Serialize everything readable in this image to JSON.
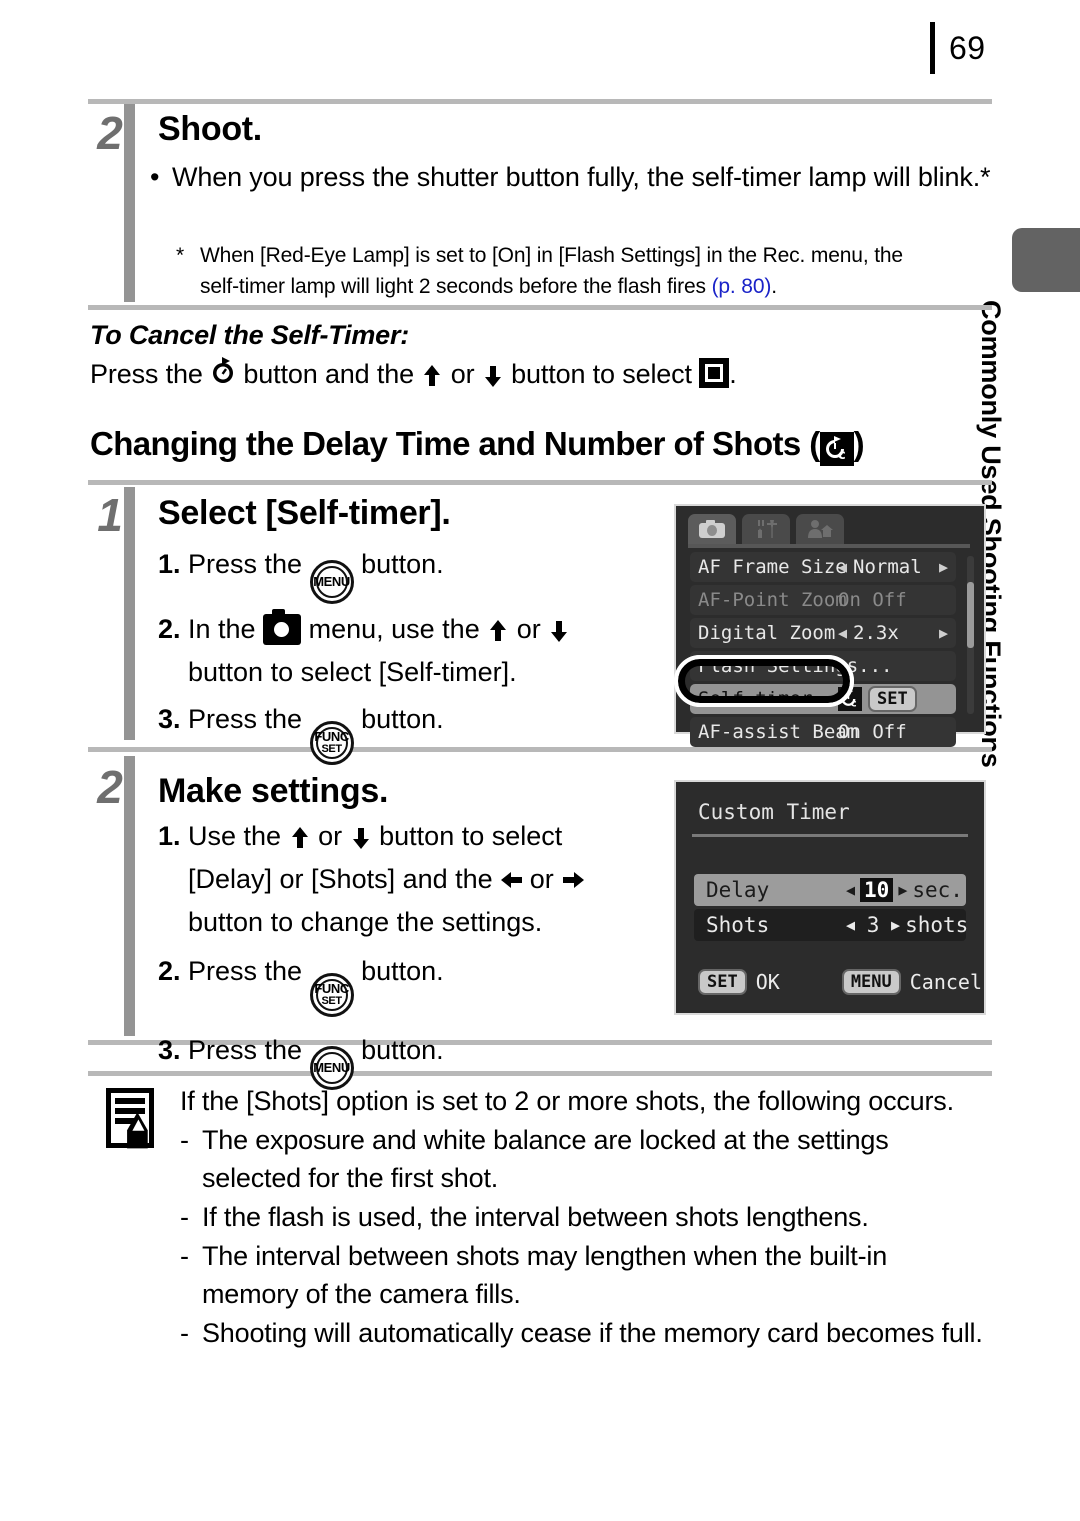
{
  "page": {
    "number": "69",
    "side_tab_label": "Commonly Used Shooting Functions"
  },
  "step_shoot": {
    "number": "2",
    "title": "Shoot.",
    "bullet": "When you press the shutter button fully, the self-timer lamp will blink.*",
    "footnote_marker": "*",
    "footnote_line1": "When [Red-Eye Lamp] is set to [On] in [Flash Settings] in the Rec. menu, the",
    "footnote_line2": "self-timer lamp will light 2 seconds before the flash fires",
    "footnote_ref": "(p. 80)",
    "footnote_end": "."
  },
  "cancel_section": {
    "title": "To Cancel the Self-Timer:",
    "text_part1": "Press the",
    "icon_selftimer": "self-timer-icon",
    "text_part2": "button and the",
    "icon_up": "arrow-up-icon",
    "text_or": "or",
    "icon_down": "arrow-down-icon",
    "text_part3": "button to select",
    "icon_off": "self-timer-off-icon",
    "text_end": "."
  },
  "main_heading": {
    "text": "Changing the Delay Time and Number of Shots (",
    "icon": "custom-timer-icon",
    "text_close": ")"
  },
  "step_select": {
    "number": "1",
    "title": "Select [Self-timer].",
    "items": [
      {
        "idx": "1.",
        "pre": "Press the",
        "icon": "menu-button-icon",
        "post": "button."
      },
      {
        "idx": "2.",
        "pre": "In the",
        "icon": "rec-menu-camera-icon",
        "mid": "menu, use the",
        "icon2": "arrow-up-icon",
        "or": "or",
        "icon3": "arrow-down-icon",
        "post": "button to select [Self-timer]."
      },
      {
        "idx": "3.",
        "pre": "Press the",
        "icon": "func-set-button-icon",
        "post": "button."
      }
    ]
  },
  "step_settings": {
    "number": "2",
    "title": "Make settings.",
    "items": [
      {
        "idx": "1.",
        "pre": "Use the",
        "icon": "arrow-up-icon",
        "or": "or",
        "icon2": "arrow-down-icon",
        "mid": "button to select",
        "line2pre": "[Delay] or [Shots] and the",
        "icon3": "arrow-left-icon",
        "or2": "or",
        "icon4": "arrow-right-icon",
        "line3": "button to change the settings."
      },
      {
        "idx": "2.",
        "pre": "Press the",
        "icon": "func-set-button-icon",
        "post": "button."
      },
      {
        "idx": "3.",
        "pre": "Press the",
        "icon": "menu-button-icon",
        "post": "button."
      }
    ]
  },
  "lcd_rec_menu": {
    "tabs": [
      {
        "name": "rec-tab",
        "icon": "camera-icon",
        "active": true
      },
      {
        "name": "setup-tab",
        "icon": "tools-icon",
        "active": false
      },
      {
        "name": "my-camera-tab",
        "icon": "person-house-icon",
        "active": false
      }
    ],
    "rows": [
      {
        "label": "AF Frame Size",
        "value": "Normal",
        "state": "normal",
        "arrows": true
      },
      {
        "label": "AF-Point Zoom",
        "value": "On Off",
        "state": "dim",
        "arrows": false
      },
      {
        "label": "Digital Zoom",
        "value": "2.3x",
        "state": "normal",
        "arrows": true
      },
      {
        "label": "Flash Settings...",
        "value": "",
        "state": "normal",
        "arrows": false
      },
      {
        "label": "Self-timer",
        "value": "",
        "state": "selected",
        "badge": "SET",
        "icon": "custom-timer-icon",
        "arrows": false
      },
      {
        "label": "AF-assist Beam",
        "value": "On Off",
        "state": "normal",
        "arrows": false
      }
    ]
  },
  "lcd_custom_timer": {
    "title": "Custom Timer",
    "rows": [
      {
        "label": "Delay",
        "value": "10",
        "unit": "sec.",
        "highlighted": true,
        "value_inverted": true
      },
      {
        "label": "Shots",
        "value": "3",
        "unit": "shots",
        "highlighted": false,
        "value_inverted": false
      }
    ],
    "footer": [
      {
        "badge": "SET",
        "label": "OK"
      },
      {
        "badge": "MENU",
        "label": "Cancel"
      }
    ]
  },
  "note": {
    "icon": "memo-pencil-icon",
    "intro": "If the [Shots] option is set to 2 or more shots, the following occurs.",
    "dash": "-",
    "bullets": [
      "The exposure and white balance are locked at the settings selected for the first shot.",
      "If the flash is used, the interval between shots lengthens.",
      "The interval between shots may lengthen when the built-in memory of the camera fills.",
      "Shooting will automatically cease if the memory card becomes full."
    ]
  },
  "colors": {
    "accent_blue": "#1a23c8",
    "rule_gray": "#b8b8b8",
    "step_gray": "#6f6f6f",
    "bar_gray": "#949494",
    "lcd_bg": "#2c2c2c",
    "side_tab": "#636363"
  }
}
